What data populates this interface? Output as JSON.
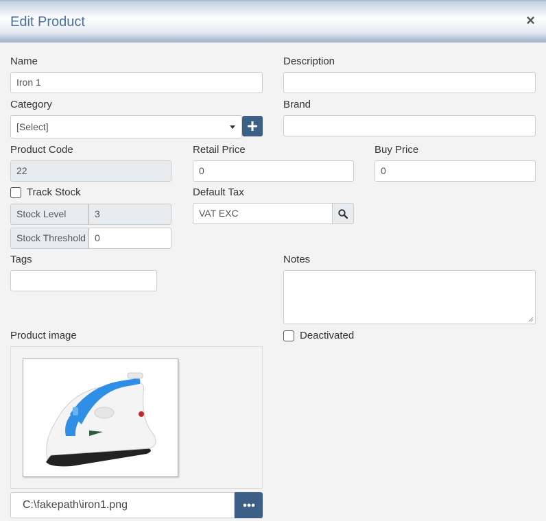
{
  "dialog": {
    "title": "Edit Product",
    "close_label": "×"
  },
  "fields": {
    "name": {
      "label": "Name",
      "value": "Iron 1"
    },
    "description": {
      "label": "Description",
      "value": ""
    },
    "category": {
      "label": "Category",
      "selected": "[Select]"
    },
    "brand": {
      "label": "Brand",
      "value": ""
    },
    "product_code": {
      "label": "Product Code",
      "value": "22"
    },
    "retail_price": {
      "label": "Retail Price",
      "value": "0"
    },
    "buy_price": {
      "label": "Buy Price",
      "value": "0"
    },
    "track_stock": {
      "label": "Track Stock",
      "checked": false
    },
    "default_tax": {
      "label": "Default Tax",
      "value": "VAT EXC"
    },
    "stock_level": {
      "label": "Stock Level",
      "value": "3"
    },
    "stock_threshold": {
      "label": "Stock Threshold",
      "value": "0"
    },
    "tags": {
      "label": "Tags",
      "value": ""
    },
    "notes": {
      "label": "Notes",
      "value": ""
    },
    "deactivated": {
      "label": "Deactivated",
      "checked": false
    },
    "product_image": {
      "label": "Product image",
      "file_path": "C:\\fakepath\\iron1.png"
    }
  },
  "icons": {
    "add": "plus-icon",
    "search": "search-icon",
    "browse": "ellipsis-icon",
    "dropdown": "caret-down-icon"
  },
  "colors": {
    "accent": "#3c5f86",
    "title": "#4a6fa0"
  }
}
